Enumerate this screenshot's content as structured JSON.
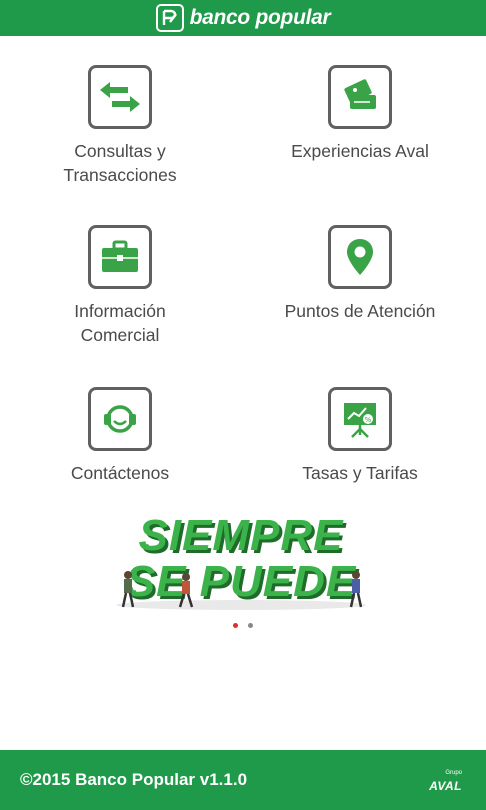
{
  "header": {
    "brand": "banco popular"
  },
  "menu": [
    {
      "id": "consultas",
      "icon": "transfer-arrows-icon",
      "label_lines": [
        "Consultas y",
        "Transacciones"
      ]
    },
    {
      "id": "experiencias",
      "icon": "tickets-icon",
      "label_lines": [
        "Experiencias Aval"
      ]
    },
    {
      "id": "informacion",
      "icon": "briefcase-icon",
      "label_lines": [
        "Información",
        "Comercial"
      ]
    },
    {
      "id": "puntos",
      "icon": "location-pin-icon",
      "label_lines": [
        "Puntos de Atención"
      ]
    },
    {
      "id": "contactenos",
      "icon": "headset-icon",
      "label_lines": [
        "Contáctenos"
      ]
    },
    {
      "id": "tasas",
      "icon": "presentation-chart-icon",
      "label_lines": [
        "Tasas y Tarifas"
      ]
    }
  ],
  "banner": {
    "line1": "SIEMPRE",
    "line2": "SE PUEDE"
  },
  "carousel": {
    "total": 2,
    "active": 1
  },
  "footer": {
    "copyright": "©2015 Banco Popular v1.1.0",
    "aval_small": "Grupo",
    "aval_big": "AVAL"
  },
  "colors": {
    "brand_green": "#1f9a4a",
    "icon_green": "#3aa348",
    "frame_gray": "#5f6062",
    "active_dot": "#d8332f"
  }
}
